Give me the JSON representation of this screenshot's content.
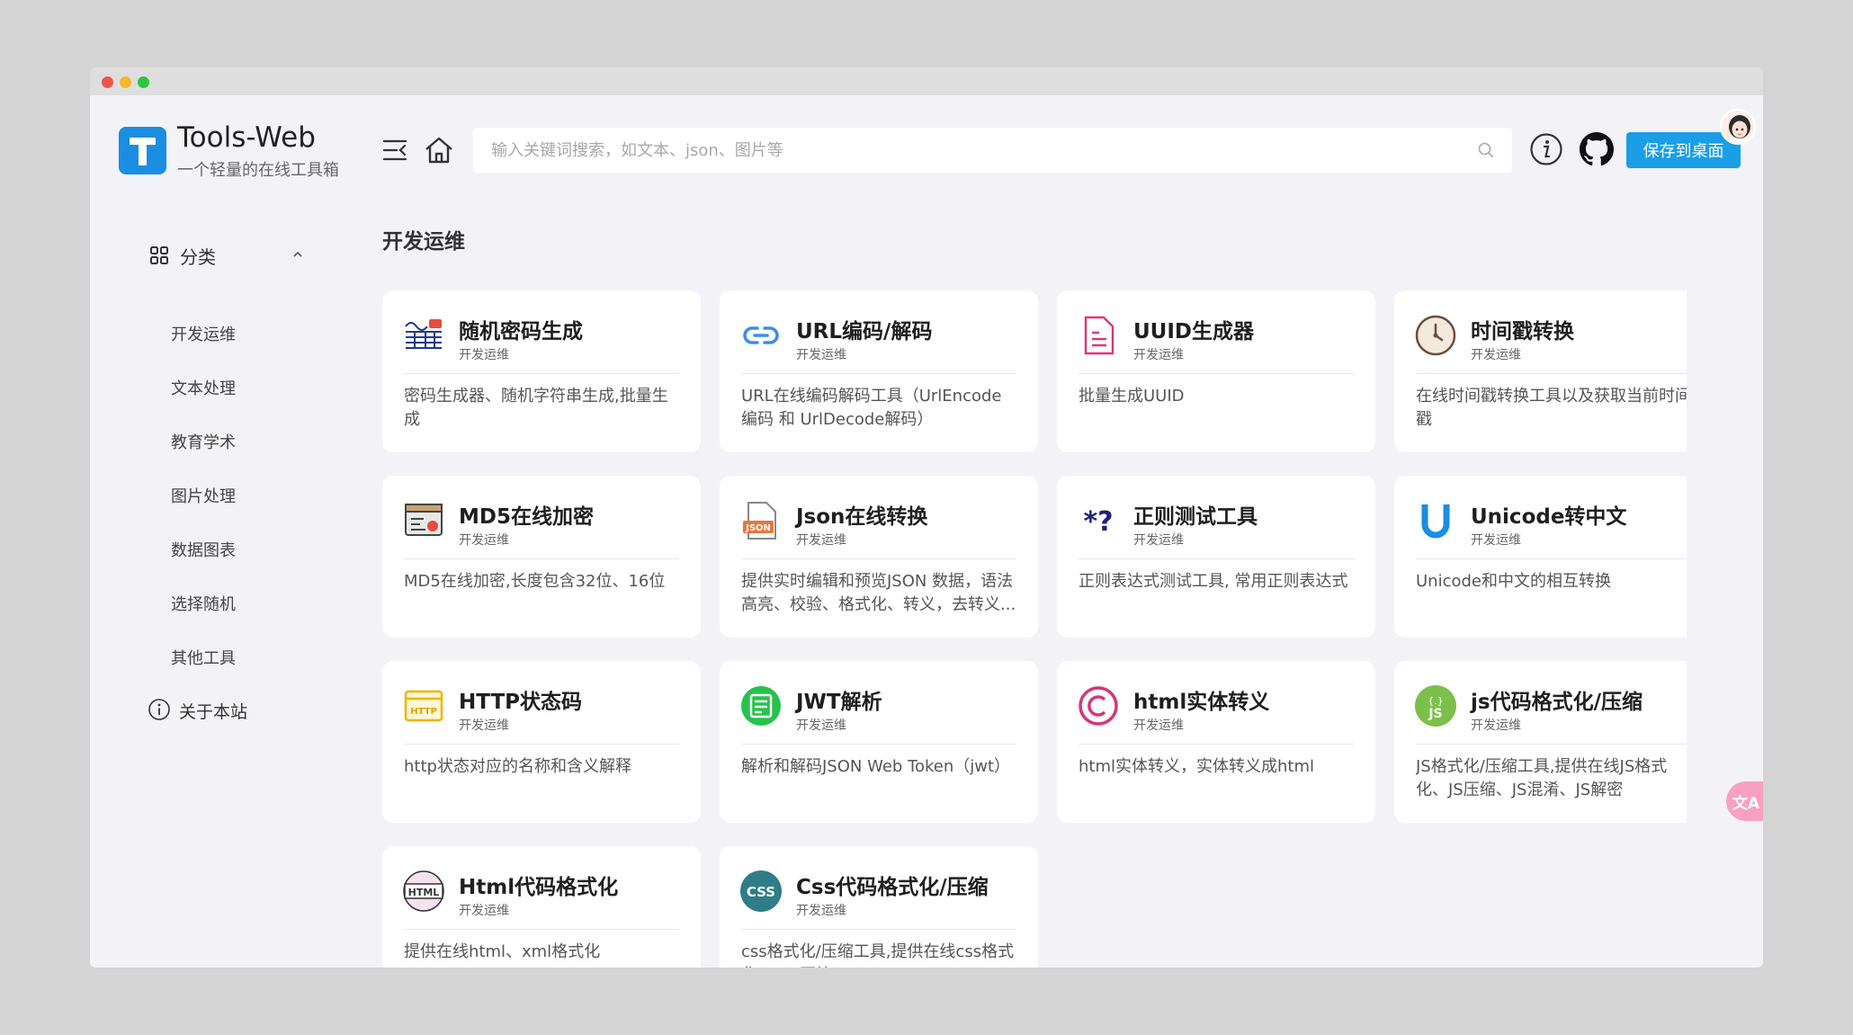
{
  "app": {
    "title": "Tools-Web",
    "subtitle": "一个轻量的在线工具箱",
    "logo_letter": "T",
    "brand_color": "#1a8ee1"
  },
  "header": {
    "search_placeholder": "输入关键词搜索，如文本、json、图片等",
    "save_label": "保存到桌面",
    "icons": [
      "menu-fold-icon",
      "home-icon",
      "search-icon",
      "info-icon",
      "github-icon"
    ]
  },
  "sidebar": {
    "category_label": "分类",
    "items": [
      {
        "label": "开发运维"
      },
      {
        "label": "文本处理"
      },
      {
        "label": "教育学术"
      },
      {
        "label": "图片处理"
      },
      {
        "label": "数据图表"
      },
      {
        "label": "选择随机"
      },
      {
        "label": "其他工具"
      }
    ],
    "about_label": "关于本站"
  },
  "main": {
    "section_title": "开发运维",
    "cards": [
      {
        "title": "随机密码生成",
        "category": "开发运维",
        "desc": "密码生成器、随机字符串生成,批量生成",
        "icon": "password-icon"
      },
      {
        "title": "URL编码/解码",
        "category": "开发运维",
        "desc": "URL在线编码解码工具（UrlEncode编码 和 UrlDecode解码）",
        "icon": "link-icon"
      },
      {
        "title": "UUID生成器",
        "category": "开发运维",
        "desc": "批量生成UUID",
        "icon": "document-icon"
      },
      {
        "title": "时间戳转换",
        "category": "开发运维",
        "desc": "在线时间戳转换工具以及获取当前时间戳",
        "icon": "clock-icon"
      },
      {
        "title": "MD5在线加密",
        "category": "开发运维",
        "desc": "MD5在线加密,长度包含32位、16位",
        "icon": "md5-icon"
      },
      {
        "title": "Json在线转换",
        "category": "开发运维",
        "desc": "提供实时编辑和预览JSON 数据，语法高亮、校验、格式化、转义，去转义...",
        "icon": "json-file-icon"
      },
      {
        "title": "正则测试工具",
        "category": "开发运维",
        "desc": "正则表达式测试工具, 常用正则表达式",
        "icon": "regex-icon"
      },
      {
        "title": "Unicode转中文",
        "category": "开发运维",
        "desc": "Unicode和中文的相互转换",
        "icon": "unicode-icon"
      },
      {
        "title": "HTTP状态码",
        "category": "开发运维",
        "desc": "http状态对应的名称和含义解释",
        "icon": "http-icon"
      },
      {
        "title": "JWT解析",
        "category": "开发运维",
        "desc": "解析和解码JSON Web Token（jwt）",
        "icon": "jwt-icon"
      },
      {
        "title": "html实体转义",
        "category": "开发运维",
        "desc": "html实体转义，实体转义成html",
        "icon": "copyright-icon"
      },
      {
        "title": "js代码格式化/压缩",
        "category": "开发运维",
        "desc": "JS格式化/压缩工具,提供在线JS格式化、JS压缩、JS混淆、JS解密",
        "icon": "js-icon"
      },
      {
        "title": "Html代码格式化",
        "category": "开发运维",
        "desc": "提供在线html、xml格式化",
        "icon": "html-icon"
      },
      {
        "title": "Css代码格式化/压缩",
        "category": "开发运维",
        "desc": "css格式化/压缩工具,提供在线css格式化、css压缩",
        "icon": "css-icon"
      }
    ]
  },
  "icon_text": {
    "http": "HTTP",
    "json": "JSON",
    "html": "HTML",
    "css": "CSS",
    "js": "JS",
    "js_braces": "{.}",
    "regex": "*?",
    "translate": "文A"
  }
}
